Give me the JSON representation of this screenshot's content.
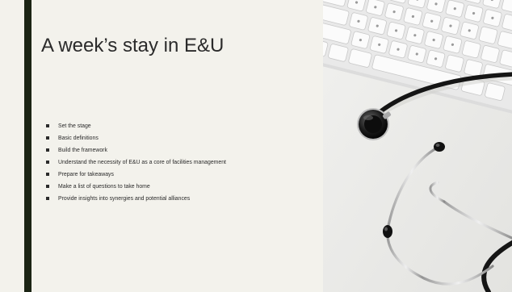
{
  "slide": {
    "title": "A week’s stay in E&U",
    "bullets": [
      "Set the stage",
      "Basic definitions",
      "Build the framework",
      "Understand the necessity of E&U as a core of facilities management",
      "Prepare for takeaways",
      "Make a list of questions to take home",
      "Provide insights into synergies and potential alliances"
    ],
    "colors": {
      "background": "#f3f2ec",
      "accent_bar": "#1b2414",
      "text": "#2b2b2b"
    }
  }
}
